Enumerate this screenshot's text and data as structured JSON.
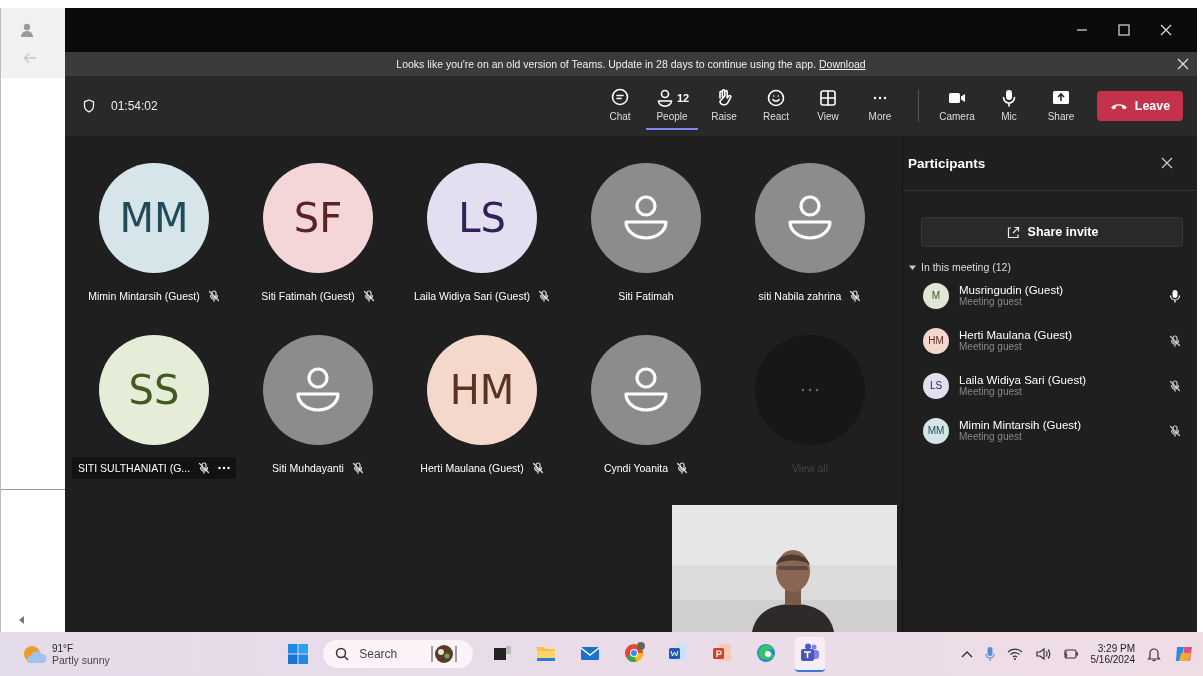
{
  "window_controls": [
    {
      "kind": "minimize"
    },
    {
      "kind": "maximize"
    },
    {
      "kind": "close"
    }
  ],
  "banner": {
    "text": "Looks like you're on an old version of Teams. Update in 28 days to continue using the app.",
    "link": "Download"
  },
  "toolbar": {
    "timer": "01:54:02",
    "actions": [
      {
        "kind": "chat",
        "label": "Chat",
        "selected": false
      },
      {
        "kind": "people",
        "label": "People",
        "badge": "12",
        "selected": true
      },
      {
        "kind": "raise",
        "label": "Raise",
        "selected": false
      },
      {
        "kind": "react",
        "label": "React",
        "selected": false
      },
      {
        "kind": "view",
        "label": "View",
        "selected": false
      },
      {
        "kind": "more",
        "label": "More",
        "selected": false
      }
    ],
    "devices": [
      {
        "kind": "camera",
        "label": "Camera"
      },
      {
        "kind": "mic",
        "label": "Mic"
      },
      {
        "kind": "share",
        "label": "Share"
      }
    ],
    "leave": "Leave"
  },
  "tiles": [
    {
      "kind": "initials",
      "initials": "MM",
      "color": "#d6e5ea",
      "name": "Mimin Mintarsih (Guest)",
      "muted": true,
      "highlighted": false
    },
    {
      "kind": "initials",
      "initials": "SF",
      "color": "#f4d6d9",
      "name": "Siti Fatimah (Guest)",
      "muted": true,
      "highlighted": false
    },
    {
      "kind": "initials",
      "initials": "LS",
      "color": "#e3dff0",
      "name": "Laila Widiya Sari (Guest)",
      "muted": true,
      "highlighted": false
    },
    {
      "kind": "placeholder",
      "name": "Siti Fatimah",
      "muted": false,
      "highlighted": false
    },
    {
      "kind": "placeholder",
      "name": "siti Nabila zahrina",
      "muted": true,
      "highlighted": false
    },
    {
      "kind": "initials",
      "initials": "SS",
      "color": "#e5edd9",
      "name": "SITI SULTHANIATI (G...",
      "muted": true,
      "highlighted": true
    },
    {
      "kind": "placeholder",
      "name": "Siti Muhdayanti",
      "muted": true,
      "highlighted": false
    },
    {
      "kind": "initials",
      "initials": "HM",
      "color": "#f4d8cc",
      "name": "Herti Maulana (Guest)",
      "muted": true,
      "highlighted": false
    },
    {
      "kind": "placeholder",
      "name": "Cyndi Yoanita",
      "muted": true,
      "highlighted": false
    },
    {
      "kind": "overflow",
      "name": "View all"
    }
  ],
  "participants_panel": {
    "title": "Participants",
    "share_button": "Share invite",
    "section": {
      "label": "In this meeting (12)",
      "expanded": true
    },
    "people": [
      {
        "initials": "M",
        "color": "#e0e7d8",
        "name": "Musringudin (Guest)",
        "role": "Meeting guest",
        "muted": false
      },
      {
        "initials": "HM",
        "color": "#f4d7cf",
        "name": "Herti Maulana (Guest)",
        "role": "Meeting guest",
        "muted": true
      },
      {
        "initials": "LS",
        "color": "#e2e0f0",
        "name": "Laila Widiya Sari (Guest)",
        "role": "Meeting guest",
        "muted": true
      },
      {
        "initials": "MM",
        "color": "#d4e6ea",
        "name": "Mimin Mintarsih (Guest)",
        "role": "Meeting guest",
        "muted": true
      }
    ]
  },
  "taskbar": {
    "weather": {
      "temp": "91°F",
      "condition": "Partly sunny"
    },
    "search": {
      "placeholder": "Search"
    },
    "apps": [
      {
        "kind": "task-view",
        "active": false
      },
      {
        "kind": "folder",
        "active": false
      },
      {
        "kind": "mail",
        "active": false
      },
      {
        "kind": "browser-circle",
        "active": false
      },
      {
        "kind": "doc-blue",
        "active": false
      },
      {
        "kind": "doc-orange",
        "active": false
      },
      {
        "kind": "browser-wave",
        "active": false
      },
      {
        "kind": "people-app",
        "active": true
      }
    ],
    "tray": {
      "time": "3:29 PM",
      "date": "5/16/2024"
    }
  }
}
